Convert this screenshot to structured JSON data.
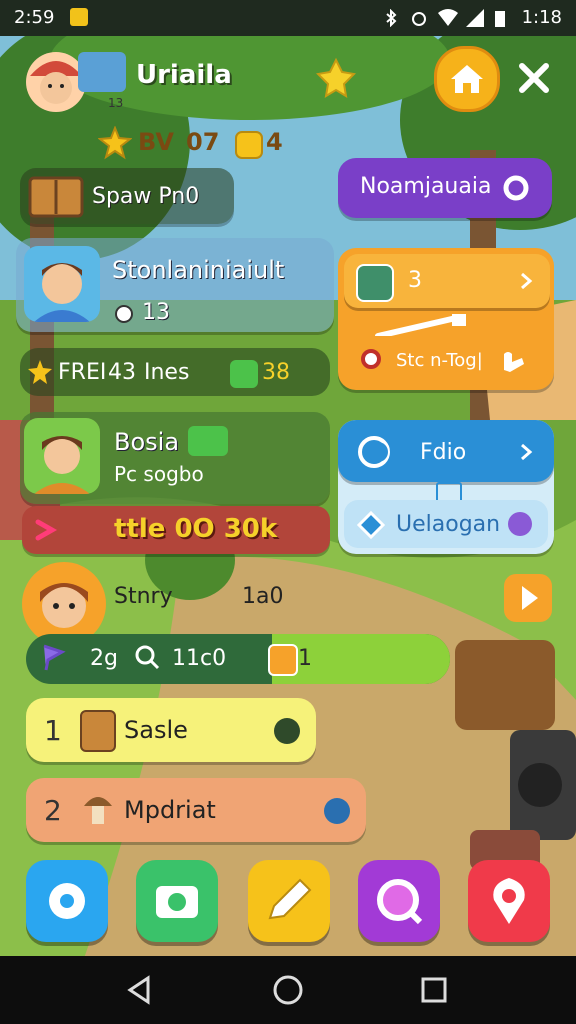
{
  "status_bar": {
    "time": "2:59",
    "clock": "1:18"
  },
  "header": {
    "player_name": "Uriaila",
    "player_level": "13"
  },
  "currency": {
    "stars": "BV",
    "hearts": "07",
    "coins": "4"
  },
  "quest_book": {
    "label": "Spaw Pn0"
  },
  "primary_action": {
    "label": "Noamjauaia"
  },
  "friend_card": {
    "name": "Stonlaniniaiult",
    "score": "13"
  },
  "friend_stats": {
    "stars": "FREI",
    "count": "43",
    "unit": "Ines",
    "gems": "38"
  },
  "orange_panel": {
    "value": "3",
    "tool_label": "Stc n-Tog|"
  },
  "player2": {
    "name": "Bosia",
    "subtitle": "Pc sogbo"
  },
  "event_banner": {
    "label": "ttle 0O 30k"
  },
  "blue_panel": {
    "title": "Fdio",
    "action_label": "Uelaogan"
  },
  "player3": {
    "name": "Stnry",
    "score": "1a0"
  },
  "progress": {
    "level": "2g",
    "timer": "11c0",
    "coins": "1",
    "fill": 0.42
  },
  "tasks": [
    {
      "rank": "1",
      "label": "Sasle"
    },
    {
      "rank": "2",
      "label": "Mpdriat"
    }
  ],
  "colors": {
    "sky": "#7fbfd8",
    "grass": "#6fa63a",
    "purple": "#7a3fc8",
    "orange": "#f6a22a",
    "blue": "#2a8fd6"
  }
}
